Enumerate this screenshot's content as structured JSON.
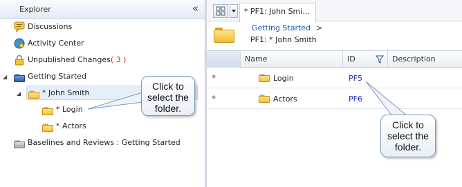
{
  "explorer": {
    "title": "Explorer",
    "collapse_glyph": "«",
    "items": [
      {
        "label": "Discussions",
        "icon": "discussion-icon"
      },
      {
        "label": "Activity Center",
        "icon": "globe-icon"
      },
      {
        "label": "Unpublished Changes",
        "count": "( 3 )",
        "icon": "lock-icon"
      },
      {
        "label": "Getting Started",
        "icon": "blue-folder-icon"
      },
      {
        "label": "* John Smith",
        "icon": "folder-icon"
      },
      {
        "label": "* Login",
        "icon": "folder-icon"
      },
      {
        "label": "* Actors",
        "icon": "folder-icon"
      },
      {
        "label": "Baselines and Reviews : Getting Started",
        "icon": "grey-folder-icon"
      }
    ]
  },
  "callouts": {
    "left": "Click to select the folder.",
    "right": "Click to select the folder."
  },
  "tab": {
    "label": "* PF1: John Smi..."
  },
  "breadcrumb": {
    "link": "Getting Started",
    "separator": ">",
    "page": "PF1: * John Smith"
  },
  "grid": {
    "columns": [
      "Name",
      "ID",
      "Description"
    ],
    "rows": [
      {
        "marker": "*",
        "name": "Login",
        "id": "PF5"
      },
      {
        "marker": "*",
        "name": "Actors",
        "id": "PF6"
      }
    ]
  },
  "colors": {
    "link": "#1f56b3",
    "id_link": "#1f2fb3",
    "count": "#e02020",
    "folder": "#f3c13a",
    "header_gradient": "#e4ebf5"
  }
}
